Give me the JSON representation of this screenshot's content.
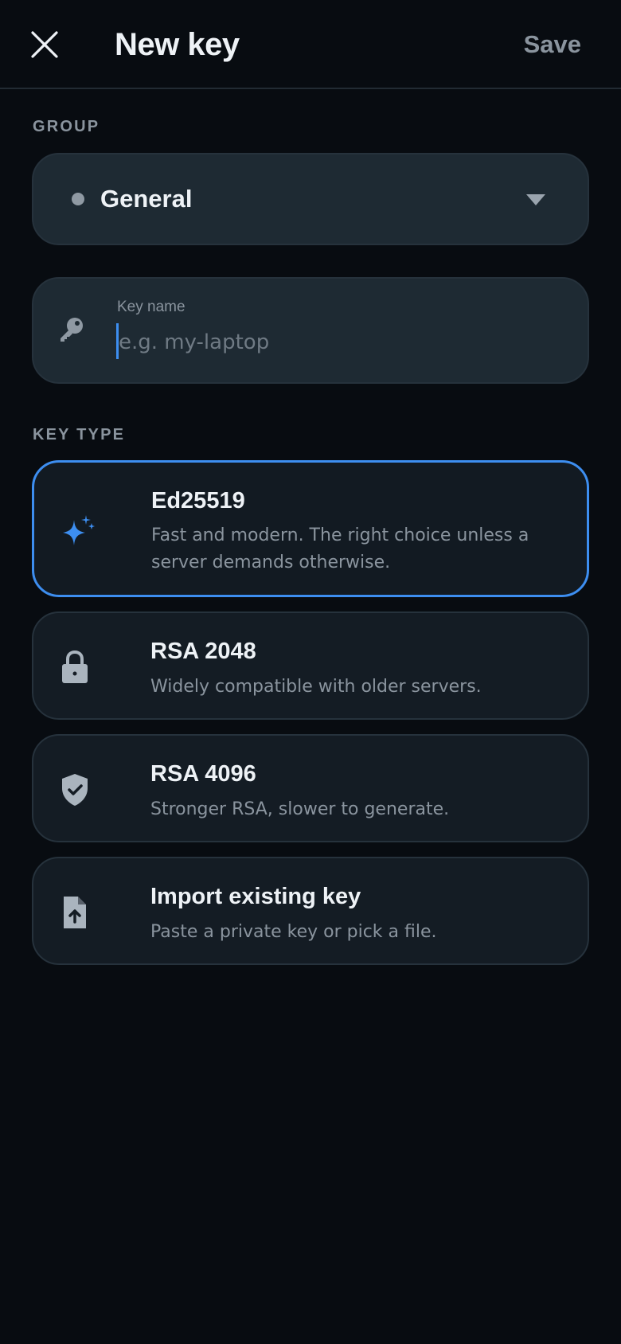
{
  "header": {
    "title": "New key",
    "save_label": "Save",
    "close_icon": "close-icon"
  },
  "group": {
    "section_label": "GROUP",
    "selected_value": "General",
    "dot_color": "#8f99a3"
  },
  "key_name": {
    "label": "Key name",
    "placeholder": "e.g. my-laptop",
    "value": ""
  },
  "key_type": {
    "section_label": "KEY TYPE",
    "options": [
      {
        "title": "Ed25519",
        "description": "Fast and modern. The right choice unless a server demands otherwise.",
        "icon": "sparkle-icon",
        "selected": true
      },
      {
        "title": "RSA 2048",
        "description": "Widely compatible with older servers.",
        "icon": "lock-icon",
        "selected": false
      },
      {
        "title": "RSA 4096",
        "description": "Stronger RSA, slower to generate.",
        "icon": "shield-check-icon",
        "selected": false
      },
      {
        "title": "Import existing key",
        "description": "Paste a private key or pick a file.",
        "icon": "file-upload-icon",
        "selected": false
      }
    ]
  },
  "colors": {
    "accent": "#3d8ef0",
    "background": "#080c11",
    "card": "#141c24",
    "field": "#1e2a33",
    "muted_text": "#8a949e"
  }
}
